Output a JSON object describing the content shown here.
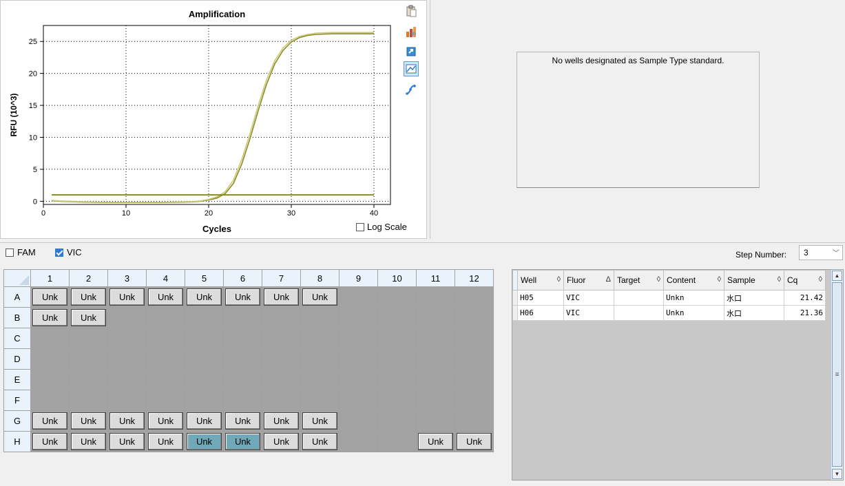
{
  "chart_data": {
    "type": "line",
    "title": "Amplification",
    "xlabel": "Cycles",
    "ylabel": "RFU (10^3)",
    "xlim": [
      0,
      42
    ],
    "ylim": [
      -0.5,
      27.5
    ],
    "xticks": [
      0,
      10,
      20,
      30,
      40
    ],
    "yticks": [
      0,
      5,
      10,
      15,
      20,
      25
    ],
    "grid": true,
    "series": [
      {
        "color": "#8a8a20",
        "x": [
          1,
          2,
          4,
          6,
          8,
          10,
          12,
          14,
          16,
          18,
          19,
          20,
          21,
          22,
          23,
          24,
          25,
          26,
          27,
          28,
          29,
          30,
          31,
          32,
          33,
          34,
          35,
          36,
          37,
          38,
          39,
          40
        ],
        "y": [
          0.1,
          0.0,
          -0.1,
          -0.15,
          -0.2,
          -0.2,
          -0.2,
          -0.2,
          -0.15,
          -0.1,
          0.0,
          0.2,
          0.5,
          1.2,
          2.8,
          5.8,
          9.8,
          14.2,
          18.3,
          21.5,
          23.6,
          24.9,
          25.6,
          25.95,
          26.1,
          26.15,
          26.2,
          26.2,
          26.2,
          26.2,
          26.2,
          26.2
        ]
      },
      {
        "color": "#c9c97a",
        "x": [
          1,
          2,
          4,
          6,
          8,
          10,
          12,
          14,
          16,
          18,
          19,
          20,
          21,
          22,
          23,
          24,
          25,
          26,
          27,
          28,
          29,
          30,
          31,
          32,
          33,
          34,
          35,
          36,
          37,
          38,
          39,
          40
        ],
        "y": [
          0.15,
          0.05,
          -0.05,
          -0.1,
          -0.15,
          -0.15,
          -0.15,
          -0.15,
          -0.1,
          -0.05,
          0.05,
          0.3,
          0.7,
          1.5,
          3.3,
          6.5,
          10.6,
          15.0,
          19.0,
          22.0,
          24.0,
          25.2,
          25.8,
          26.1,
          26.3,
          26.35,
          26.4,
          26.4,
          26.4,
          26.4,
          26.4,
          26.4
        ]
      },
      {
        "color": "#8a8a20",
        "threshold": true,
        "x": [
          1,
          40
        ],
        "y": [
          1.0,
          1.0
        ]
      }
    ]
  },
  "chart": {
    "log_scale_label": "Log Scale",
    "log_scale_checked": false,
    "tools": [
      "clipboard-icon",
      "bar-chart-settings-icon",
      "export-icon",
      "zoom-chart-icon",
      "curve-fit-icon"
    ]
  },
  "standard_curve": {
    "message": "No wells designated as Sample Type standard."
  },
  "filter_bar": {
    "fam_label": "FAM",
    "fam_checked": false,
    "vic_label": "VIC",
    "vic_checked": true,
    "step_label": "Step Number:",
    "step_value": "3"
  },
  "plate": {
    "columns": [
      "1",
      "2",
      "3",
      "4",
      "5",
      "6",
      "7",
      "8",
      "9",
      "10",
      "11",
      "12"
    ],
    "rows": [
      {
        "label": "A",
        "wells": [
          "Unk",
          "Unk",
          "Unk",
          "Unk",
          "Unk",
          "Unk",
          "Unk",
          "Unk",
          "",
          "",
          "",
          ""
        ]
      },
      {
        "label": "B",
        "wells": [
          "Unk",
          "Unk",
          "",
          "",
          "",
          "",
          "",
          "",
          "",
          "",
          "",
          ""
        ]
      },
      {
        "label": "C",
        "wells": [
          "",
          "",
          "",
          "",
          "",
          "",
          "",
          "",
          "",
          "",
          "",
          ""
        ]
      },
      {
        "label": "D",
        "wells": [
          "",
          "",
          "",
          "",
          "",
          "",
          "",
          "",
          "",
          "",
          "",
          ""
        ]
      },
      {
        "label": "E",
        "wells": [
          "",
          "",
          "",
          "",
          "",
          "",
          "",
          "",
          "",
          "",
          "",
          ""
        ]
      },
      {
        "label": "F",
        "wells": [
          "",
          "",
          "",
          "",
          "",
          "",
          "",
          "",
          "",
          "",
          "",
          ""
        ]
      },
      {
        "label": "G",
        "wells": [
          "Unk",
          "Unk",
          "Unk",
          "Unk",
          "Unk",
          "Unk",
          "Unk",
          "Unk",
          "",
          "",
          "",
          ""
        ]
      },
      {
        "label": "H",
        "wells": [
          "Unk",
          "Unk",
          "Unk",
          "Unk",
          "Unk",
          "Unk",
          "Unk",
          "Unk",
          "",
          "",
          "Unk",
          "Unk"
        ]
      }
    ],
    "selected": [
      "H5",
      "H6"
    ]
  },
  "results": {
    "headers": [
      {
        "label": "Well",
        "sort": "◊"
      },
      {
        "label": "Fluor",
        "sort": "Δ"
      },
      {
        "label": "Target",
        "sort": "◊"
      },
      {
        "label": "Content",
        "sort": "◊"
      },
      {
        "label": "Sample",
        "sort": "◊"
      },
      {
        "label": "Cq",
        "sort": "◊"
      }
    ],
    "rows": [
      {
        "well": "H05",
        "fluor": "VIC",
        "target": "",
        "content": "Unkn",
        "sample": "水口",
        "cq": "21.42"
      },
      {
        "well": "H06",
        "fluor": "VIC",
        "target": "",
        "content": "Unkn",
        "sample": "水口",
        "cq": "21.36"
      }
    ]
  }
}
